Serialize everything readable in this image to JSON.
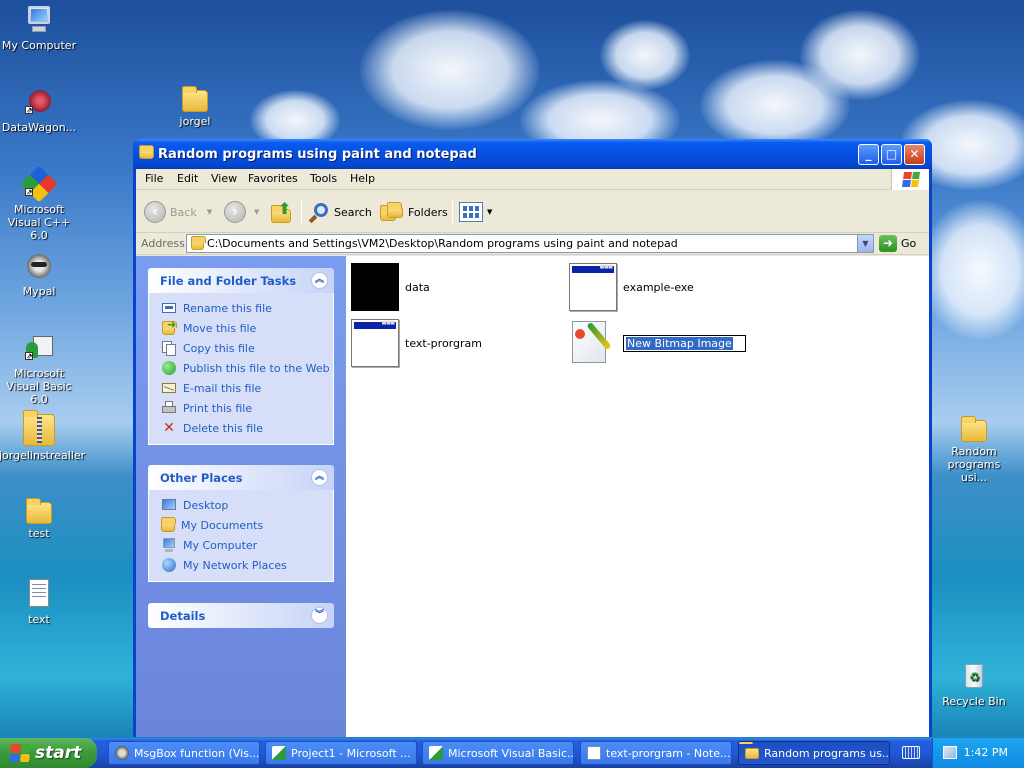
{
  "desktop": {
    "icons": [
      {
        "label": "My Computer",
        "icon": "my-computer-icon"
      },
      {
        "label": "DataWagon...",
        "icon": "datawagon-icon"
      },
      {
        "label": "Microsoft Visual C++ 6.0",
        "icon": "visual-cpp-icon"
      },
      {
        "label": "Mypal",
        "icon": "mypal-raccoon-icon"
      },
      {
        "label": "Microsoft Visual Basic 6.0",
        "icon": "visual-basic-icon"
      },
      {
        "label": "jorgelinstrealler",
        "icon": "installer-zip-icon"
      },
      {
        "label": "test",
        "icon": "folder-icon"
      },
      {
        "label": "text",
        "icon": "text-file-icon"
      },
      {
        "label": "jorgel",
        "icon": "folder-icon"
      },
      {
        "label": "Random programs usi...",
        "icon": "folder-icon"
      },
      {
        "label": "Recycle Bin",
        "icon": "recycle-bin-icon"
      }
    ]
  },
  "window": {
    "title": "Random programs using paint and notepad",
    "menu": [
      "File",
      "Edit",
      "View",
      "Favorites",
      "Tools",
      "Help"
    ],
    "toolbar": {
      "back": "Back",
      "search": "Search",
      "folders": "Folders"
    },
    "address": {
      "label": "Address",
      "value": "C:\\Documents and Settings\\VM2\\Desktop\\Random programs using paint and notepad",
      "go": "Go"
    },
    "tasks": {
      "file_folder": {
        "title": "File and Folder Tasks",
        "links": [
          "Rename this file",
          "Move this file",
          "Copy this file",
          "Publish this file to the Web",
          "E-mail this file",
          "Print this file",
          "Delete this file"
        ]
      },
      "other_places": {
        "title": "Other Places",
        "links": [
          "Desktop",
          "My Documents",
          "My Computer",
          "My Network Places"
        ]
      },
      "details": {
        "title": "Details"
      }
    },
    "files": [
      {
        "name": "data",
        "type": "black-bitmap"
      },
      {
        "name": "example-exe",
        "type": "program"
      },
      {
        "name": "text-prorgram",
        "type": "program"
      },
      {
        "name": "New Bitmap Image",
        "type": "bitmap-renaming"
      }
    ]
  },
  "taskbar": {
    "start": "start",
    "tasks": [
      "MsgBox function (Vis...",
      "Project1 - Microsoft ...",
      "Microsoft Visual Basic...",
      "text-prorgram - Note...",
      "Random programs us..."
    ],
    "clock": "1:42 PM"
  },
  "colors": {
    "title_blue": "#0550e0",
    "task_link": "#215dc6",
    "selection": "#316ac5",
    "start_green": "#3d9b3d"
  }
}
